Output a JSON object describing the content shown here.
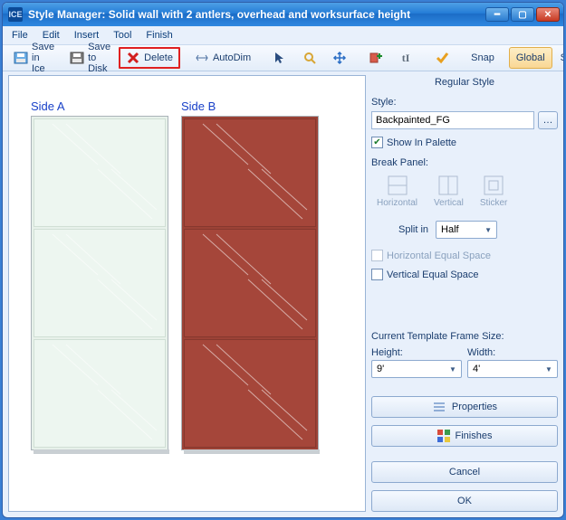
{
  "window": {
    "title": "Style Manager: Solid wall with 2 antlers, overhead and worksurface height",
    "app_icon": "ICE"
  },
  "menu": {
    "file": "File",
    "edit": "Edit",
    "insert": "Insert",
    "tool": "Tool",
    "finish": "Finish"
  },
  "toolbar": {
    "save_ice": "Save in Ice",
    "save_disk": "Save to Disk",
    "delete": "Delete",
    "autodim": "AutoDim",
    "snap": "Snap",
    "global": "Global",
    "style": "Style"
  },
  "canvas": {
    "side_a": "Side A",
    "side_b": "Side B"
  },
  "panel": {
    "heading": "Regular Style",
    "style_label": "Style:",
    "style_value": "Backpainted_FG",
    "show_in_palette": "Show In Palette",
    "break_panel": "Break Panel:",
    "break_horizontal": "Horizontal",
    "break_vertical": "Vertical",
    "break_sticker": "Sticker",
    "split_label": "Split in",
    "split_value": "Half",
    "h_equal": "Horizontal Equal Space",
    "v_equal": "Vertical Equal Space",
    "frame_size": "Current Template Frame Size:",
    "height_label": "Height:",
    "width_label": "Width:",
    "height_value": "9'",
    "width_value": "4'",
    "properties": "Properties",
    "finishes": "Finishes",
    "cancel": "Cancel",
    "ok": "OK"
  }
}
